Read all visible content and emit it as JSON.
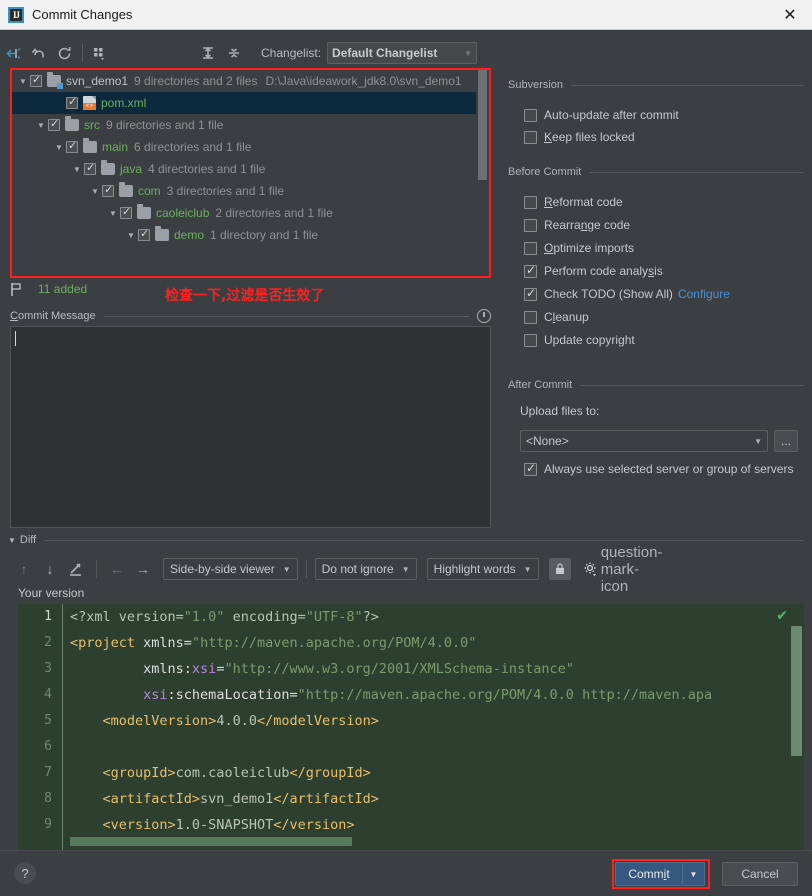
{
  "window": {
    "title": "Commit Changes",
    "app_icon": "intellij-idea-icon",
    "close_label": "✕"
  },
  "toolbar": {
    "buttons": [
      {
        "name": "show-diff-icon",
        "glyph": "diff"
      },
      {
        "name": "revert-icon",
        "glyph": "revert"
      },
      {
        "name": "refresh-icon",
        "glyph": "refresh"
      },
      {
        "name": "group-by-icon",
        "glyph": "group"
      }
    ],
    "expand_all_label": "expand-all-icon",
    "collapse_all_label": "collapse-all-icon",
    "changelist_label": "Changelist:",
    "changelist_value": "Default Changelist"
  },
  "tree": {
    "rows": [
      {
        "indent": 0,
        "twisty": "▼",
        "checked": true,
        "icon": "folder-badge",
        "name": "svn_demo1",
        "name_color": "w",
        "meta": "9 directories and 2 files",
        "path": "D:\\Java\\ideawork_jdk8.0\\svn_demo1",
        "selected": false
      },
      {
        "indent": 2,
        "twisty": "",
        "checked": true,
        "icon": "xml",
        "name": "pom.xml",
        "name_color": "g",
        "meta": "",
        "path": "",
        "selected": true
      },
      {
        "indent": 1,
        "twisty": "▼",
        "checked": true,
        "icon": "folder",
        "name": "src",
        "name_color": "g",
        "meta": "9 directories and 1 file",
        "path": "",
        "selected": false
      },
      {
        "indent": 2,
        "twisty": "▼",
        "checked": true,
        "icon": "folder",
        "name": "main",
        "name_color": "g",
        "meta": "6 directories and 1 file",
        "path": "",
        "selected": false
      },
      {
        "indent": 3,
        "twisty": "▼",
        "checked": true,
        "icon": "folder",
        "name": "java",
        "name_color": "g",
        "meta": "4 directories and 1 file",
        "path": "",
        "selected": false
      },
      {
        "indent": 4,
        "twisty": "▼",
        "checked": true,
        "icon": "folder",
        "name": "com",
        "name_color": "g",
        "meta": "3 directories and 1 file",
        "path": "",
        "selected": false
      },
      {
        "indent": 5,
        "twisty": "▼",
        "checked": true,
        "icon": "folder",
        "name": "caoleiclub",
        "name_color": "g",
        "meta": "2 directories and 1 file",
        "path": "",
        "selected": false
      },
      {
        "indent": 6,
        "twisty": "▼",
        "checked": true,
        "icon": "folder",
        "name": "demo",
        "name_color": "g",
        "meta": "1 directory and 1 file",
        "path": "",
        "selected": false
      }
    ]
  },
  "status": {
    "flag_icon": "changelist-flag-icon",
    "added_count": "11 added"
  },
  "annotation": {
    "text": "检查一下,过滤是否生效了",
    "color": "#ff2020"
  },
  "commit_message": {
    "label": "Commit Message",
    "label_mnemonic": "C",
    "value": "",
    "history_icon": "clock-icon"
  },
  "right_panel": {
    "subversion": {
      "title": "Subversion",
      "options": [
        {
          "label": "Auto-update after commit",
          "checked": false,
          "mnemonic": ""
        },
        {
          "label": "Keep files locked",
          "checked": false,
          "mnemonic": "K"
        }
      ]
    },
    "before_commit": {
      "title": "Before Commit",
      "options": [
        {
          "label": "Reformat code",
          "checked": false,
          "mnemonic": "R"
        },
        {
          "label": "Rearrange code",
          "checked": false,
          "mnemonic": "n"
        },
        {
          "label": "Optimize imports",
          "checked": false,
          "mnemonic": "O"
        },
        {
          "label": "Perform code analysis",
          "checked": true,
          "mnemonic": "s"
        },
        {
          "label": "Check TODO (Show All)",
          "checked": true,
          "mnemonic": "",
          "link": "Configure"
        },
        {
          "label": "Cleanup",
          "checked": false,
          "mnemonic": "l"
        },
        {
          "label": "Update copyright",
          "checked": false,
          "mnemonic": ""
        }
      ]
    },
    "after_commit": {
      "title": "After Commit",
      "upload_label": "Upload files to:",
      "upload_value": "<None>",
      "browse_label": "...",
      "always_use_label": "Always use selected server or group of servers",
      "always_use_checked": true
    }
  },
  "diff": {
    "section_label": "Diff",
    "nav_buttons": [
      {
        "name": "previous-difference-icon",
        "glyph": "↑",
        "dim": true
      },
      {
        "name": "next-difference-icon",
        "glyph": "↓",
        "dim": false
      },
      {
        "name": "annotate-icon",
        "glyph": "pen",
        "dim": false
      },
      {
        "name": "previous-file-icon",
        "glyph": "←",
        "dim": true
      },
      {
        "name": "next-file-icon",
        "glyph": "→",
        "dim": false
      }
    ],
    "viewer_mode": "Side-by-side viewer",
    "ignore_mode": "Do not ignore",
    "highlight_mode": "Highlight words",
    "lock_icon": "lock-icon",
    "settings_icon": "gear-icon",
    "help_icon": "question-mark-icon",
    "pane_title": "Your version",
    "status_check": "✔",
    "lines": [
      {
        "n": "1",
        "current": true,
        "parts": [
          {
            "t": "pi",
            "s": "<?xml version="
          },
          {
            "t": "str",
            "s": "\"1.0\""
          },
          {
            "t": "pi",
            "s": " encoding="
          },
          {
            "t": "str",
            "s": "\"UTF-8\""
          },
          {
            "t": "pi",
            "s": "?>"
          }
        ]
      },
      {
        "n": "2",
        "current": false,
        "parts": [
          {
            "t": "tag",
            "s": "<project "
          },
          {
            "t": "attr",
            "s": "xmlns="
          },
          {
            "t": "str",
            "s": "\"http://maven.apache.org/POM/4.0.0\""
          }
        ]
      },
      {
        "n": "3",
        "current": false,
        "parts": [
          {
            "t": "attr",
            "s": "         xmlns:"
          },
          {
            "t": "attrp",
            "s": "xsi"
          },
          {
            "t": "attr",
            "s": "="
          },
          {
            "t": "str",
            "s": "\"http://www.w3.org/2001/XMLSchema-instance\""
          }
        ]
      },
      {
        "n": "4",
        "current": false,
        "parts": [
          {
            "t": "attrp",
            "s": "         xsi"
          },
          {
            "t": "attr",
            "s": ":schemaLocation="
          },
          {
            "t": "str",
            "s": "\"http://maven.apache.org/POM/4.0.0 http://maven.apa"
          }
        ]
      },
      {
        "n": "5",
        "current": false,
        "parts": [
          {
            "t": "tag",
            "s": "    <modelVersion>"
          },
          {
            "t": "txt",
            "s": "4.0.0"
          },
          {
            "t": "tag",
            "s": "</modelVersion>"
          }
        ]
      },
      {
        "n": "6",
        "current": false,
        "parts": []
      },
      {
        "n": "7",
        "current": false,
        "parts": [
          {
            "t": "tag",
            "s": "    <groupId>"
          },
          {
            "t": "txt",
            "s": "com.caoleiclub"
          },
          {
            "t": "tag",
            "s": "</groupId>"
          }
        ]
      },
      {
        "n": "8",
        "current": false,
        "parts": [
          {
            "t": "tag",
            "s": "    <artifactId>"
          },
          {
            "t": "txt",
            "s": "svn_demo1"
          },
          {
            "t": "tag",
            "s": "</artifactId>"
          }
        ]
      },
      {
        "n": "9",
        "current": false,
        "parts": [
          {
            "t": "tag",
            "s": "    <version>"
          },
          {
            "t": "txt",
            "s": "1.0-SNAPSHOT"
          },
          {
            "t": "tag",
            "s": "</version>"
          }
        ]
      }
    ]
  },
  "footer": {
    "help_label": "?",
    "commit_label": "Commit",
    "commit_mnemonic": "i",
    "commit_dropdown": "▼",
    "cancel_label": "Cancel",
    "commit_highlight_color": "#ff1f1f",
    "commit_button_color": "#365880"
  }
}
